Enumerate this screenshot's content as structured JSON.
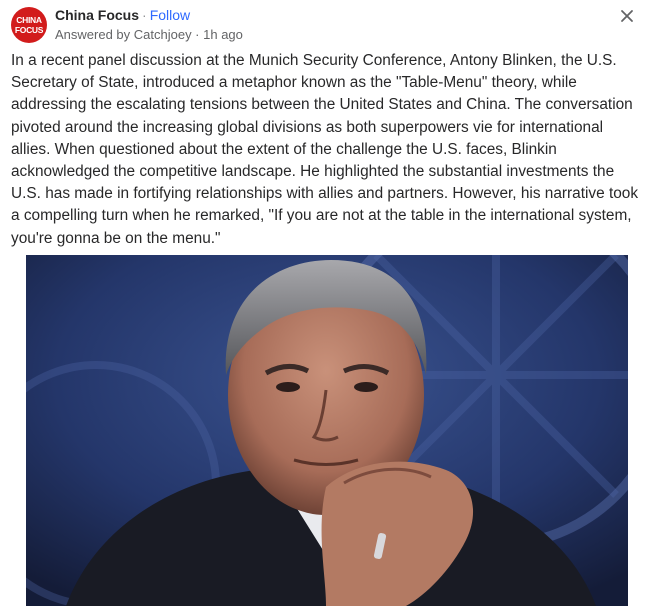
{
  "space": {
    "name": "China Focus",
    "logo_text_top": "CHINA",
    "logo_text_bottom": "FOCUS",
    "separator": "·",
    "follow_label": "Follow"
  },
  "byline": "Answered by Catchjoey · 1h ago",
  "close_icon": "close-icon",
  "post": {
    "text": "In a recent panel discussion at the Munich Security Conference, Antony Blinken, the U.S. Secretary of State, introduced a metaphor known as the \"Table-Menu\" theory, while addressing the escalating tensions between the United States and China. The conversation pivoted around the increasing global divisions as both superpowers vie for international allies. When questioned about the extent of the challenge the U.S. faces, Blinkin acknowledged the competitive landscape. He highlighted the substantial investments the U.S. has made in fortifying relationships with allies and partners. However, his narrative took a compelling turn when he remarked, \"If you are not at the table in the international system, you're gonna be on the menu.\""
  },
  "colors": {
    "brand_red": "#d21c1c",
    "follow_blue": "#2e69ff",
    "text": "#282829",
    "muted": "#636466",
    "photo_background": "#1c2648"
  }
}
